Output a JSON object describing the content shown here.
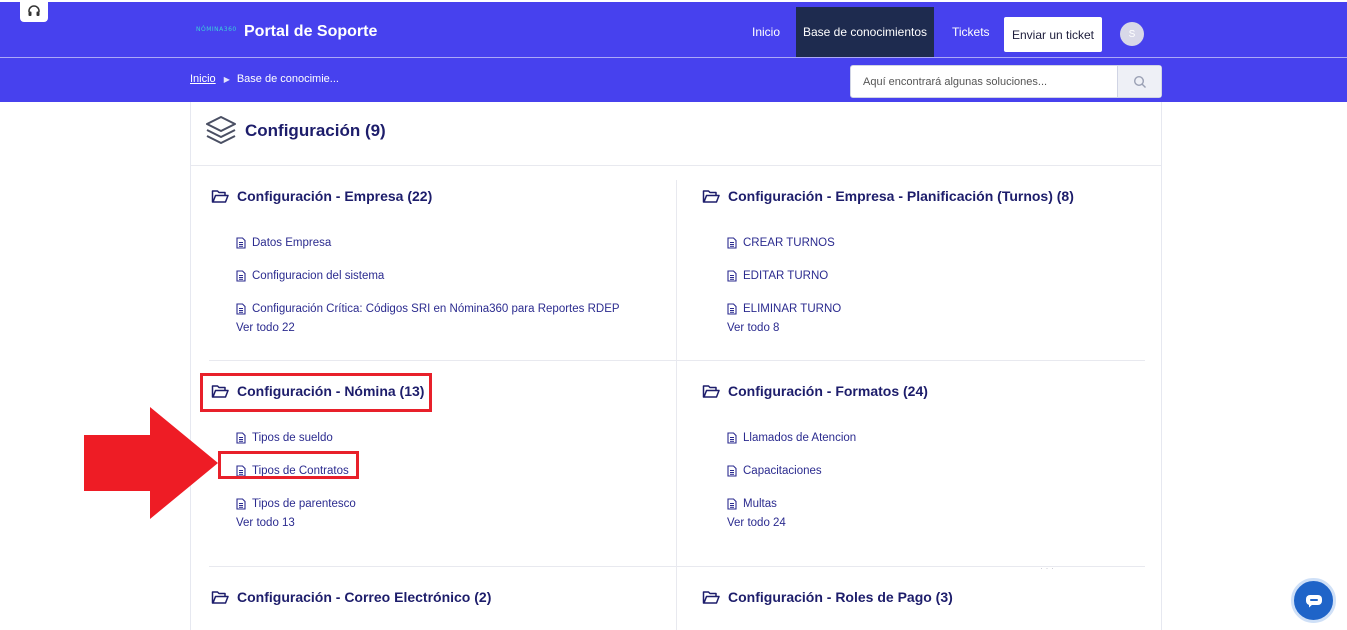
{
  "header": {
    "logo_text": "NÓMINA360",
    "portal_title": "Portal de Soporte",
    "nav": {
      "home": "Inicio",
      "knowledge_base": "Base de conocimientos",
      "tickets": "Tickets",
      "submit_ticket": "Enviar un ticket"
    },
    "avatar_initial": "S"
  },
  "breadcrumb": {
    "home": "Inicio",
    "current": "Base de conocimie..."
  },
  "search": {
    "placeholder": "Aquí encontrará algunas soluciones..."
  },
  "category": {
    "title": "Configuración (9)",
    "icon": "layers-icon"
  },
  "sections": [
    {
      "title": "Configuración - Empresa (22)",
      "articles": [
        "Datos Empresa",
        "Configuracion del sistema",
        "Configuración Crítica: Códigos SRI en Nómina360 para Reportes RDEP"
      ],
      "see_all": "Ver todo 22"
    },
    {
      "title": "Configuración - Empresa - Planificación (Turnos) (8)",
      "articles": [
        "CREAR TURNOS",
        "EDITAR TURNO",
        "ELIMINAR TURNO"
      ],
      "see_all": "Ver todo 8"
    },
    {
      "title": "Configuración - Nómina (13)",
      "articles": [
        "Tipos de sueldo",
        "Tipos de Contratos",
        "Tipos de parentesco"
      ],
      "see_all": "Ver todo 13"
    },
    {
      "title": "Configuración - Formatos (24)",
      "articles": [
        "Llamados de Atencion",
        "Capacitaciones",
        "Multas"
      ],
      "see_all": "Ver todo 24"
    },
    {
      "title": "Configuración - Correo Electrónico (2)"
    },
    {
      "title": "Configuración - Roles de Pago (3)"
    }
  ],
  "colors": {
    "header_bg": "#4741ee",
    "nav_active_bg": "#1e2b4f",
    "title_text": "#1d1d6b",
    "link_text": "#2b2b8f",
    "annotation_red": "#e8202a",
    "chat_bg": "#1f64c8"
  }
}
